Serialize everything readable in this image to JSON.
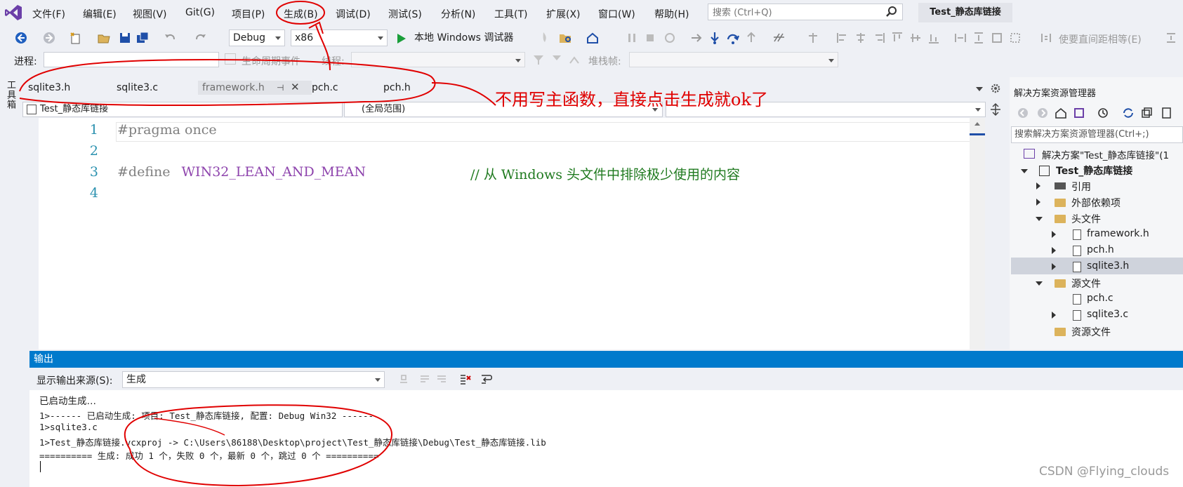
{
  "menu": {
    "items": [
      "文件(F)",
      "编辑(E)",
      "视图(V)",
      "Git(G)",
      "项目(P)",
      "生成(B)",
      "调试(D)",
      "测试(S)",
      "分析(N)",
      "工具(T)",
      "扩展(X)",
      "窗口(W)",
      "帮助(H)"
    ],
    "search_placeholder": "搜索 (Ctrl+Q)",
    "solution_title": "Test_静态库链接"
  },
  "toolbar": {
    "config": "Debug",
    "platform": "x86",
    "run_label": "本地 Windows 调试器",
    "hint_text": "使要直间距相等(E)"
  },
  "row2": {
    "process_label": "进程:",
    "lifecycle_label": "生命周期事件",
    "thread_label": "线程:",
    "stack_label": "堆栈帧:"
  },
  "toolbox_label": "工具箱",
  "tabs": [
    "sqlite3.h",
    "sqlite3.c",
    "framework.h",
    "pch.c",
    "pch.h"
  ],
  "active_tab_index": 2,
  "navbar": {
    "project": "Test_静态库链接",
    "scope": "(全局范围)"
  },
  "editor": {
    "line_numbers": [
      "1",
      "2",
      "3",
      "4"
    ],
    "line1": "#pragma once",
    "line3_keyword": "#define",
    "line3_macro": "WIN32_LEAN_AND_MEAN",
    "line3_comment": "// 从 Windows 头文件中排除极少使用的内容"
  },
  "annotation": "不用写主函数，直接点击生成就ok了",
  "solution_explorer": {
    "title": "解决方案资源管理器",
    "search_placeholder": "搜索解决方案资源管理器(Ctrl+;)",
    "solution_node": "解决方案\"Test_静态库链接\"(1",
    "project_node": "Test_静态库链接",
    "items": {
      "references": "引用",
      "external": "外部依赖项",
      "headers": "头文件",
      "framework": "framework.h",
      "pch_h": "pch.h",
      "sqlite3_h": "sqlite3.h",
      "sources": "源文件",
      "pch_c": "pch.c",
      "sqlite3_c": "sqlite3.c",
      "resources": "资源文件"
    }
  },
  "output": {
    "title": "输出",
    "source_label": "显示输出来源(S):",
    "source_value": "生成",
    "lines": [
      "已启动生成…",
      "1>------ 已启动生成: 项目: Test_静态库链接, 配置: Debug Win32 ------",
      "1>sqlite3.c",
      "1>Test_静态库链接.vcxproj -> C:\\Users\\86188\\Desktop\\project\\Test_静态库链接\\Debug\\Test_静态库链接.lib",
      "========== 生成: 成功 1 个，失败 0 个，最新 0 个，跳过 0 个 =========="
    ]
  },
  "watermark": "CSDN @Flying_clouds",
  "colors": {
    "accent": "#007acc",
    "annotation": "#e00000"
  }
}
